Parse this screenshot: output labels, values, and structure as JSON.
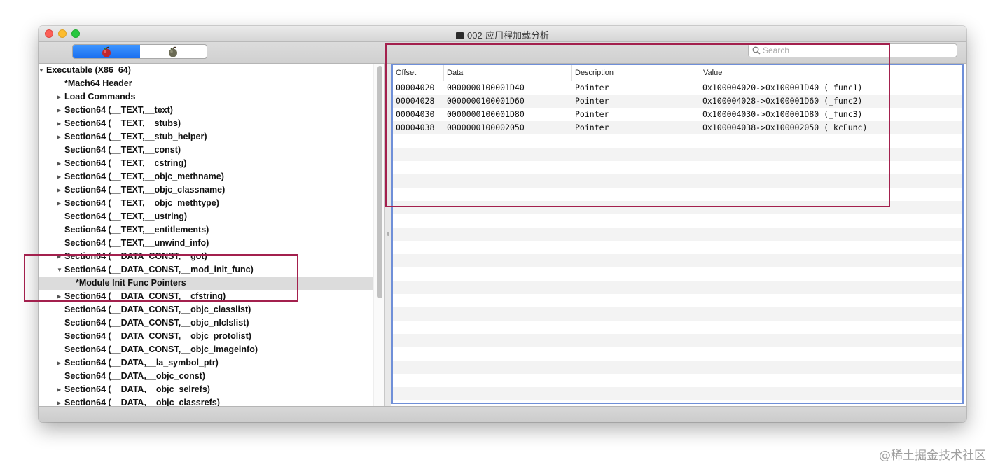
{
  "window": {
    "title": "002-应用程加载分析"
  },
  "toolbar": {
    "segments": [
      "apple-bomb-icon-red",
      "apple-bomb-icon-gray"
    ],
    "search_placeholder": "Search"
  },
  "sidebar": {
    "items": [
      {
        "label": "Executable  (X86_64)",
        "disclosure": "expanded"
      },
      {
        "label": "*Mach64 Header",
        "disclosure": "none"
      },
      {
        "label": "Load Commands",
        "disclosure": "collapsed"
      },
      {
        "label": "Section64 (__TEXT,__text)",
        "disclosure": "collapsed"
      },
      {
        "label": "Section64 (__TEXT,__stubs)",
        "disclosure": "collapsed"
      },
      {
        "label": "Section64 (__TEXT,__stub_helper)",
        "disclosure": "collapsed"
      },
      {
        "label": "Section64 (__TEXT,__const)",
        "disclosure": "none"
      },
      {
        "label": "Section64 (__TEXT,__cstring)",
        "disclosure": "collapsed"
      },
      {
        "label": "Section64 (__TEXT,__objc_methname)",
        "disclosure": "collapsed"
      },
      {
        "label": "Section64 (__TEXT,__objc_classname)",
        "disclosure": "collapsed"
      },
      {
        "label": "Section64 (__TEXT,__objc_methtype)",
        "disclosure": "collapsed"
      },
      {
        "label": "Section64 (__TEXT,__ustring)",
        "disclosure": "none"
      },
      {
        "label": "Section64 (__TEXT,__entitlements)",
        "disclosure": "none"
      },
      {
        "label": "Section64 (__TEXT,__unwind_info)",
        "disclosure": "none"
      },
      {
        "label": "Section64 (__DATA_CONST,__got)",
        "disclosure": "collapsed"
      },
      {
        "label": "Section64 (__DATA_CONST,__mod_init_func)",
        "disclosure": "expanded"
      },
      {
        "label": "*Module Init Func Pointers",
        "disclosure": "none",
        "selected": true
      },
      {
        "label": "Section64 (__DATA_CONST,__cfstring)",
        "disclosure": "collapsed"
      },
      {
        "label": "Section64 (__DATA_CONST,__objc_classlist)",
        "disclosure": "none"
      },
      {
        "label": "Section64 (__DATA_CONST,__objc_nlclslist)",
        "disclosure": "none"
      },
      {
        "label": "Section64 (__DATA_CONST,__objc_protolist)",
        "disclosure": "none"
      },
      {
        "label": "Section64 (__DATA_CONST,__objc_imageinfo)",
        "disclosure": "none"
      },
      {
        "label": "Section64 (__DATA,__la_symbol_ptr)",
        "disclosure": "collapsed"
      },
      {
        "label": "Section64 (__DATA,__objc_const)",
        "disclosure": "none"
      },
      {
        "label": "Section64 (__DATA,__objc_selrefs)",
        "disclosure": "collapsed"
      },
      {
        "label": "Section64 (__DATA,__objc_classrefs)",
        "disclosure": "collapsed"
      }
    ]
  },
  "table": {
    "columns": [
      "Offset",
      "Data",
      "Description",
      "Value"
    ],
    "rows": [
      [
        "00004020",
        "0000000100001D40",
        "Pointer",
        "0x100004020->0x100001D40 (_func1)"
      ],
      [
        "00004028",
        "0000000100001D60",
        "Pointer",
        "0x100004028->0x100001D60 (_func2)"
      ],
      [
        "00004030",
        "0000000100001D80",
        "Pointer",
        "0x100004030->0x100001D80 (_func3)"
      ],
      [
        "00004038",
        "0000000100002050",
        "Pointer",
        "0x100004038->0x100002050 (_kcFunc)"
      ]
    ]
  },
  "colors": {
    "highlight_box": "#a3204d",
    "table_focus_border": "#6f8fd8",
    "segment_active": "#1a6ff0"
  },
  "watermark": "@稀土掘金技术社区"
}
